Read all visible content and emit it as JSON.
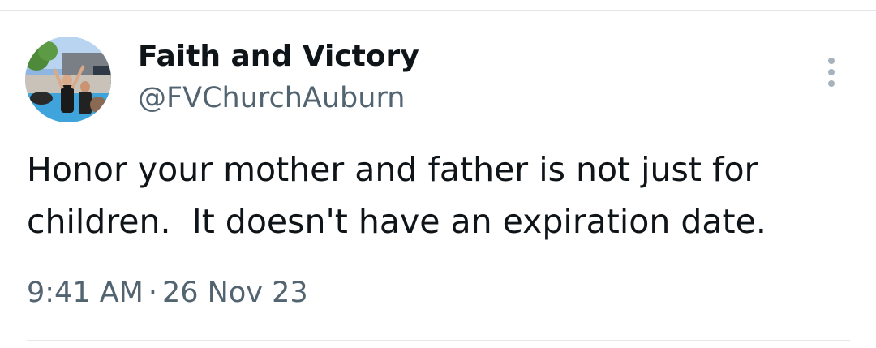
{
  "tweet": {
    "author": {
      "display_name": "Faith and Victory",
      "handle": "@FVChurchAuburn",
      "avatar_icon": "profile-photo"
    },
    "more_icon": "vertical-ellipsis-icon",
    "text": "Honor your mother and father is not just for children.  It doesn't have an expiration date.",
    "time": "9:41 AM",
    "separator": "·",
    "date": "26 Nov 23"
  },
  "colors": {
    "primary_text": "#0f1419",
    "secondary_text": "#536471",
    "divider": "#e4e8eb",
    "more_icon": "#a6b3bd"
  }
}
